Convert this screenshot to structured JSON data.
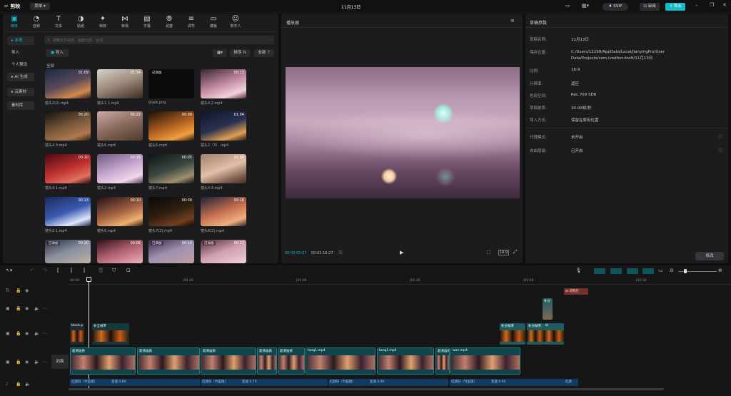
{
  "app": {
    "logo": "剪映",
    "menu_label": "菜单",
    "title": "11月13日",
    "svip": "SVIP",
    "review": "审阅",
    "export": "导出"
  },
  "media_panel": {
    "categories": [
      {
        "label": "媒体",
        "icon": "media-icon"
      },
      {
        "label": "音频",
        "icon": "audio-icon"
      },
      {
        "label": "文本",
        "icon": "text-icon"
      },
      {
        "label": "贴纸",
        "icon": "sticker-icon"
      },
      {
        "label": "特效",
        "icon": "effect-icon"
      },
      {
        "label": "转场",
        "icon": "transition-icon"
      },
      {
        "label": "字幕",
        "icon": "subtitle-icon"
      },
      {
        "label": "滤镜",
        "icon": "filter-icon"
      },
      {
        "label": "调节",
        "icon": "adjust-icon"
      },
      {
        "label": "模板",
        "icon": "template-icon"
      },
      {
        "label": "数字人",
        "icon": "avatar-icon"
      }
    ],
    "side": [
      "本地",
      "导入",
      "个人预设",
      "AI 生成",
      "云素材",
      "素材库"
    ],
    "search_placeholder": "搜索文件名称、画面元素、台词",
    "import_label": "导入",
    "sort_label": "排序",
    "filter_label": "全部",
    "section_label": "全部",
    "items": [
      {
        "name": "镜头2(2).mp4",
        "dur": "01:09",
        "tag": ""
      },
      {
        "name": "镜头1.1.mp4",
        "dur": "01:34",
        "tag": ""
      },
      {
        "name": "black.png",
        "dur": "",
        "tag": "已添加"
      },
      {
        "name": "镜头4.2.mp4",
        "dur": "00:13",
        "tag": ""
      },
      {
        "name": "镜头4.3.mp4",
        "dur": "00:20",
        "tag": ""
      },
      {
        "name": "镜头6.mp4",
        "dur": "00:22",
        "tag": ""
      },
      {
        "name": "镜头5.mp4",
        "dur": "00:09",
        "tag": ""
      },
      {
        "name": "镜头2（3）.mp4",
        "dur": "01:04",
        "tag": ""
      },
      {
        "name": "镜头4.1.mp4",
        "dur": "00:10",
        "tag": ""
      },
      {
        "name": "镜头2.mp4",
        "dur": "00:16",
        "tag": ""
      },
      {
        "name": "镜头7.mp4",
        "dur": "00:05",
        "tag": ""
      },
      {
        "name": "镜头4.4.mp4",
        "dur": "00:06",
        "tag": ""
      },
      {
        "name": "镜头2.1.mp4",
        "dur": "00:13",
        "tag": ""
      },
      {
        "name": "镜头6.mp4",
        "dur": "00:10",
        "tag": ""
      },
      {
        "name": "镜头7(2).mp4",
        "dur": "00:09",
        "tag": ""
      },
      {
        "name": "镜头6(2).mp4",
        "dur": "00:10",
        "tag": ""
      },
      {
        "name": "",
        "dur": "00:20",
        "tag": "已添加"
      },
      {
        "name": "",
        "dur": "00:06",
        "tag": ""
      },
      {
        "name": "",
        "dur": "00:14",
        "tag": "已添加"
      },
      {
        "name": "",
        "dur": "00:17",
        "tag": "已添加"
      }
    ]
  },
  "player": {
    "title": "播放器",
    "current_time": "00:00:05:07",
    "total_time": "00:02:16:27",
    "ratio": "16:9"
  },
  "draft": {
    "title": "草稿参数",
    "props": [
      {
        "k": "草稿名称:",
        "v": "11月13日"
      },
      {
        "k": "保存位置:",
        "v": "C:/Users/12199/AppData/Local/JianyingPro/User Data/Projects/com.lveditor.draft/11月13日"
      },
      {
        "k": "比例:",
        "v": "16:9"
      },
      {
        "k": "分辨率:",
        "v": "适应"
      },
      {
        "k": "色彩空间:",
        "v": "Rec.709 SDR"
      },
      {
        "k": "草稿帧率:",
        "v": "30.00帧/秒"
      },
      {
        "k": "导入方式:",
        "v": "保留在原有位置"
      },
      {
        "k": "代理模式:",
        "v": "未开启"
      },
      {
        "k": "自由层级:",
        "v": "已开启"
      }
    ],
    "modify": "修改"
  },
  "timeline": {
    "ruler": [
      "00:00",
      "|00:30",
      "|01:00",
      "|01:30",
      "|02:00",
      "|02:30"
    ],
    "cover_label": "封面",
    "top_chip": "调整后",
    "clips_v2": [
      "black.p",
      "补全帧率",
      "图.png",
      "补分帧率",
      "补分帧率",
      "补分",
      "bl"
    ],
    "clips_main": [
      "超清画质",
      "补分帧率",
      "1.mp4",
      "00:00:1",
      "超清画质",
      "补分帧率",
      "1.00:01",
      "超清画质",
      "超清画质",
      "超清画质",
      "超清画质",
      "tang1.mp4",
      "补分帧率",
      "tang1.mp4",
      "超清画质",
      "补分帧率",
      "wan.mp4",
      "00:00"
    ],
    "audio": [
      "红颜旧（竹笛版）",
      "变速 0.8X",
      "红颜旧",
      "红颜旧（竹笛版）",
      "变速 0.7X",
      "红颜旧（竹笛版）",
      "变速 0.8X",
      "红颜旧（竹笛版）",
      "变速 0.9X",
      "红颜"
    ]
  }
}
